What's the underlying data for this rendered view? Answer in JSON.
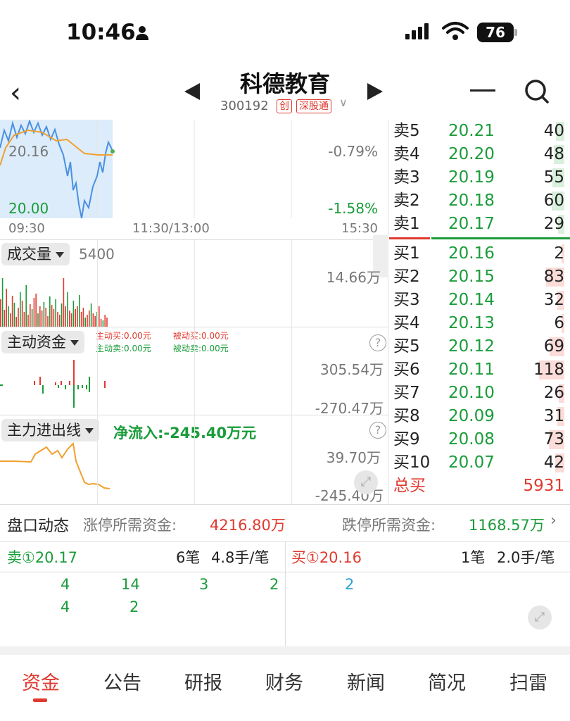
{
  "status_bar": {
    "time": "10:46",
    "battery": "76"
  },
  "nav": {
    "title": "科德教育",
    "code": "300192",
    "tag_chuang": "创",
    "tag_shenggutong": "深股通"
  },
  "price_chart": {
    "price_high_label": "20.16",
    "price_low_label": "20.00",
    "pct_high": "-0.79%",
    "pct_low": "-1.58%",
    "time_start": "09:30",
    "time_mid": "11:30/13:00",
    "time_end": "15:30"
  },
  "volume_panel": {
    "selector": "成交量",
    "value": "5400",
    "max": "14.66万"
  },
  "active_fund_panel": {
    "selector": "主动资金",
    "active_buy": "主动买:0.00元",
    "active_sell": "主动卖:0.00元",
    "passive_buy": "被动买:0.00元",
    "passive_sell": "被动卖:0.00元",
    "max": "305.54万",
    "min": "-270.47万"
  },
  "main_flow_panel": {
    "selector": "主力进出线",
    "net_inflow": "净流入:-245.40万元",
    "max": "39.70万",
    "min": "-245.40万"
  },
  "order_book": {
    "asks": [
      {
        "label": "卖5",
        "price": "20.21",
        "qty": "40"
      },
      {
        "label": "卖4",
        "price": "20.20",
        "qty": "48"
      },
      {
        "label": "卖3",
        "price": "20.19",
        "qty": "55"
      },
      {
        "label": "卖2",
        "price": "20.18",
        "qty": "60"
      },
      {
        "label": "卖1",
        "price": "20.17",
        "qty": "29"
      }
    ],
    "bids": [
      {
        "label": "买1",
        "price": "20.16",
        "qty": "2"
      },
      {
        "label": "买2",
        "price": "20.15",
        "qty": "83"
      },
      {
        "label": "买3",
        "price": "20.14",
        "qty": "32"
      },
      {
        "label": "买4",
        "price": "20.13",
        "qty": "6"
      },
      {
        "label": "买5",
        "price": "20.12",
        "qty": "69"
      },
      {
        "label": "买6",
        "price": "20.11",
        "qty": "118"
      },
      {
        "label": "买7",
        "price": "20.10",
        "qty": "26"
      },
      {
        "label": "买8",
        "price": "20.09",
        "qty": "31"
      },
      {
        "label": "买9",
        "price": "20.08",
        "qty": "73"
      },
      {
        "label": "买10",
        "price": "20.07",
        "qty": "42"
      }
    ],
    "total_label": "总买",
    "total_value": "5931"
  },
  "dynamic": {
    "title": "盘口动态",
    "limit_up_label": "涨停所需资金:",
    "limit_up_value": "4216.80万",
    "limit_down_label": "跌停所需资金:",
    "limit_down_value": "1168.57万"
  },
  "trades": {
    "sell_head": "卖①20.17",
    "sell_count": "6笔",
    "sell_avg": "4.8手/笔",
    "buy_head": "买①20.16",
    "buy_count": "1笔",
    "buy_avg": "2.0手/笔",
    "sell_nums": [
      "4",
      "14",
      "3",
      "2",
      "4",
      "2"
    ],
    "buy_nums": [
      "2"
    ]
  },
  "tabs": [
    "资金",
    "公告",
    "研报",
    "财务",
    "新闻",
    "简况",
    "扫雷"
  ],
  "colors": {
    "up": "#e03a2f",
    "down": "#1a9c3a",
    "price_line": "#4a90e2",
    "avg_line": "#f0a030"
  }
}
